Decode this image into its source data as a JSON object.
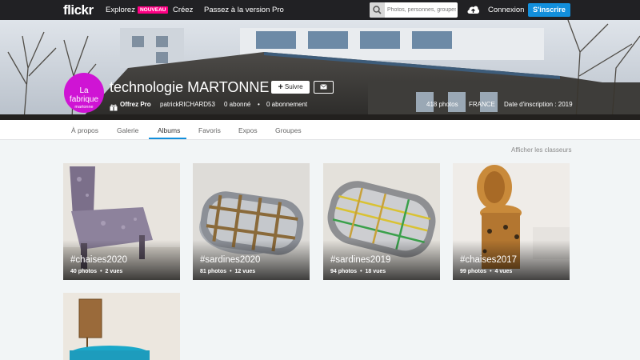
{
  "topbar": {
    "logo": "flickr",
    "explore": "Explorez",
    "explore_badge": "NOUVEAU",
    "create": "Créez",
    "upgrade": "Passez à la version Pro",
    "search_placeholder": "Photos, personnes, groupes",
    "login": "Connexion",
    "signup": "S'inscrire"
  },
  "profile": {
    "avatar_line1": "La fabrique",
    "avatar_line2": "martonne",
    "name": "technologie MARTONNE",
    "follow": "Suivre",
    "pro_link": "Offrez Pro",
    "username": "patrickRICHARD53",
    "followers": "0 abonné",
    "following": "0 abonnement",
    "photos": "418 photos",
    "country": "FRANCE",
    "joined": "Date d'inscription : 2019"
  },
  "tabs": [
    {
      "label": "À propos"
    },
    {
      "label": "Galerie"
    },
    {
      "label": "Albums"
    },
    {
      "label": "Favoris"
    },
    {
      "label": "Expos"
    },
    {
      "label": "Groupes"
    }
  ],
  "show_cases": "Afficher les classeurs",
  "albums": [
    {
      "title": "#chaises2020",
      "photos": "40 photos",
      "views": "2 vues"
    },
    {
      "title": "#sardines2020",
      "photos": "81 photos",
      "views": "12 vues"
    },
    {
      "title": "#sardines2019",
      "photos": "94 photos",
      "views": "18 vues"
    },
    {
      "title": "#chaises2017",
      "photos": "99 photos",
      "views": "4 vues"
    },
    {
      "title": "",
      "photos": "",
      "views": ""
    }
  ],
  "colors": {
    "accent": "#128fdc",
    "badge": "#ff0084",
    "avatar": "#cf14d4",
    "topbar": "#212124"
  }
}
